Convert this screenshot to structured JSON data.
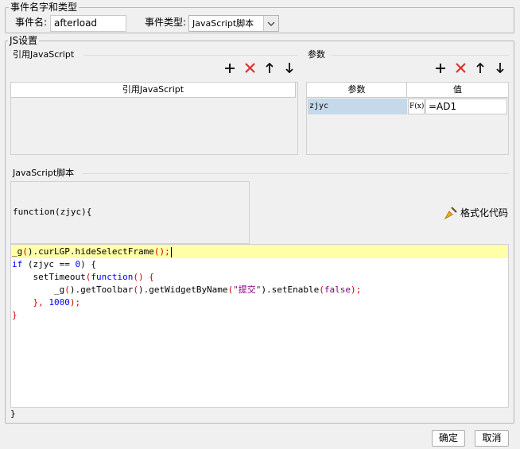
{
  "event_group": {
    "title": "事件名字和类型",
    "name_label": "事件名:",
    "name_value": "afterload",
    "type_label": "事件类型:",
    "type_value": "JavaScript脚本"
  },
  "js_group": {
    "title": "JS设置",
    "ref_js": {
      "title": "引用JavaScript",
      "column": "引用JavaScript"
    },
    "params": {
      "title": "参数",
      "col_param": "参数",
      "col_value": "值",
      "rows": [
        {
          "name": "zjyc",
          "formula_btn": "F(x)",
          "value": "=AD1"
        }
      ]
    },
    "script": {
      "title": "JavaScript脚本",
      "signature": "function(zjyc){",
      "format_label": "格式化代码",
      "closing": "}",
      "lines": [
        [
          "_g",
          "(",
          ").curLGP.hideSelectFrame",
          "(",
          ");"
        ],
        [
          "if",
          " (zjyc == ",
          "0",
          ") {"
        ],
        [
          "    setTimeout",
          "(",
          "function",
          "() {"
        ],
        [
          "        _g",
          "(",
          ").getToolbar",
          "(",
          ").getWidgetByName",
          "(",
          "\"提交\"",
          ").setEnable",
          "(",
          "false",
          ");"
        ],
        [
          "    }, ",
          "1000",
          ");"
        ],
        [
          "}"
        ]
      ]
    }
  },
  "buttons": {
    "ok": "确定",
    "cancel": "取消"
  },
  "colors": {
    "highlight_line": "#ffffa8",
    "selected_cell": "#c5d9ea",
    "delete": "#e03030"
  }
}
